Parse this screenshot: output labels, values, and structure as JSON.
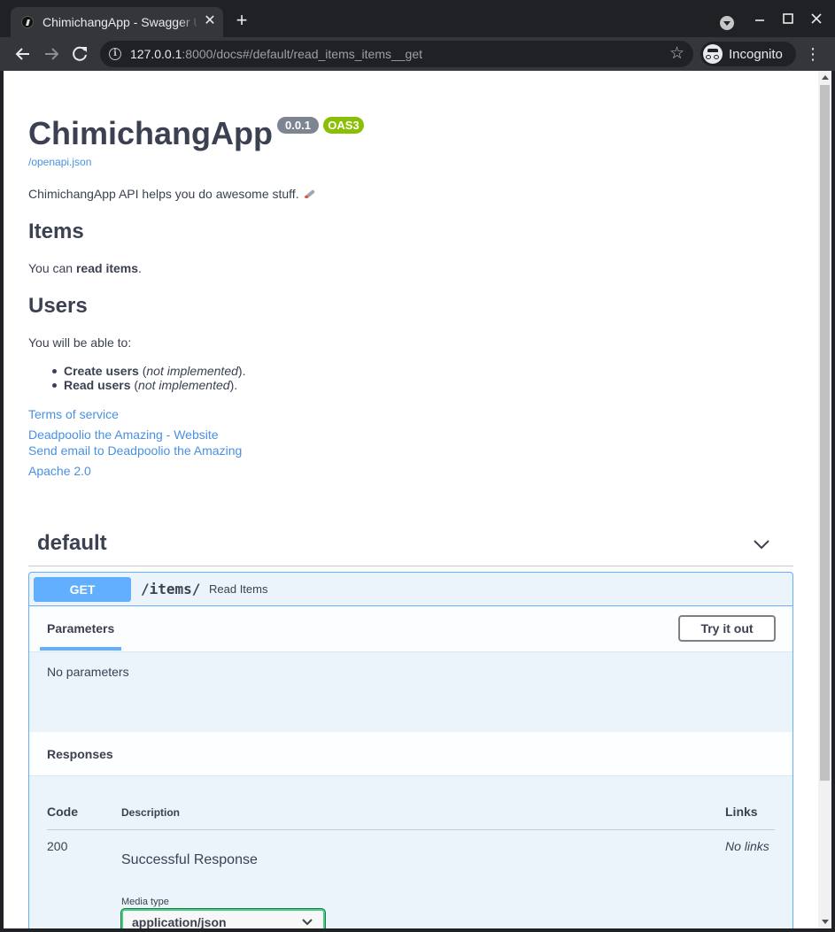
{
  "browser": {
    "tab_title": "ChimichangApp - Swagger UI",
    "tab_close": "✕",
    "new_tab": "+",
    "url_host": "127.0.0.1",
    "url_rest": ":8000/docs#/default/read_items_items__get",
    "incognito_label": "Incognito",
    "icons": {
      "back": "arrow-left-icon",
      "forward": "arrow-right-icon",
      "reload": "reload-icon",
      "info": "info-icon",
      "star": "star-icon",
      "menu": "kebab-menu-icon"
    },
    "colors": {
      "frame": "#202124",
      "toolbar": "#35363a"
    }
  },
  "info": {
    "title": "ChimichangApp",
    "version": "0.0.1",
    "oas": "OAS3",
    "openapi_link": "/openapi.json",
    "description": "ChimichangApp API helps you do awesome stuff.",
    "items_heading": "Items",
    "items_text_prefix": "You can ",
    "items_text_bold": "read items",
    "items_text_suffix": ".",
    "users_heading": "Users",
    "users_text": "You will be able to:",
    "bullets": [
      {
        "bold": "Create users",
        "pre": " (",
        "italic": "not implemented",
        "post": ")."
      },
      {
        "bold": "Read users",
        "pre": " (",
        "italic": "not implemented",
        "post": ")."
      }
    ],
    "terms_link": "Terms of service",
    "contact_website_link": "Deadpoolio the Amazing - Website",
    "contact_email_link": "Send email to Deadpoolio the Amazing",
    "license_link": "Apache 2.0",
    "colors": {
      "text": "#3b4151",
      "link": "#4990e2",
      "version_badge": "#7d8492",
      "oas_badge": "#89bf04"
    }
  },
  "operations": {
    "tag": "default",
    "method": "GET",
    "path": "/items/",
    "summary": "Read Items",
    "parameters_tab": "Parameters",
    "try_it_out": "Try it out",
    "no_parameters": "No parameters",
    "responses_title": "Responses",
    "columns": {
      "code": "Code",
      "description": "Description",
      "links": "Links"
    },
    "responses": [
      {
        "code": "200",
        "description": "Successful Response",
        "links": "No links"
      }
    ],
    "media_type_label": "Media type",
    "media_type_value": "application/json",
    "colors": {
      "get": "#61affe",
      "get_bg": "#ebf3fb"
    }
  }
}
